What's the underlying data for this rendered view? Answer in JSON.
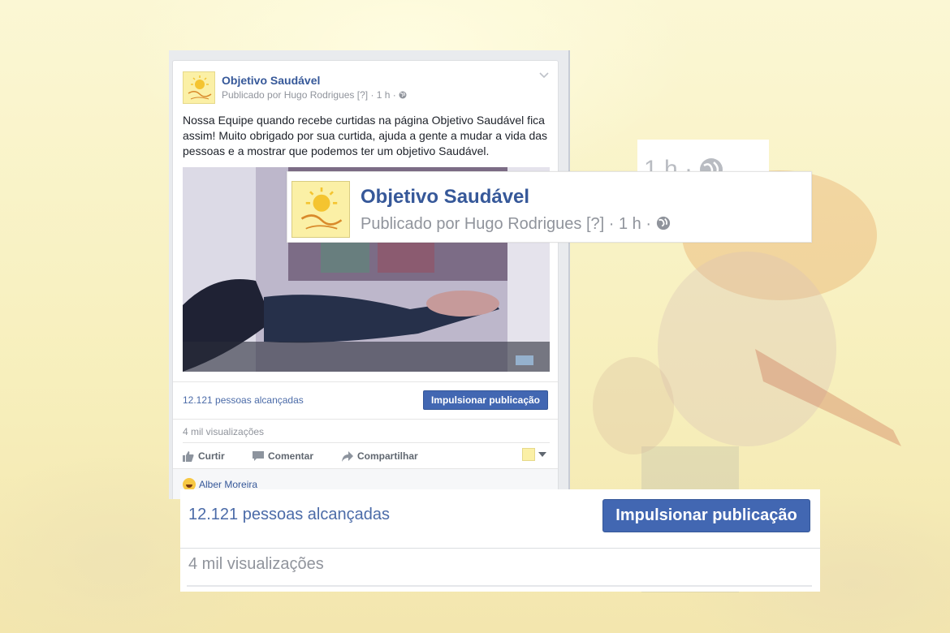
{
  "post": {
    "page_name": "Objetivo Saudável",
    "byline": "Publicado por Hugo Rodrigues [?] · 1 h ·",
    "text": "Nossa Equipe quando recebe curtidas na página Objetivo Saudável fica assim! Muito obrigado por sua curtida, ajuda a gente a mudar a vida das pessoas e a mostrar que podemos ter um objetivo Saudável.",
    "reach": "12.121 pessoas alcançadas",
    "boost_label": "Impulsionar publicação",
    "views": "4 mil visualizações",
    "actions": {
      "like": "Curtir",
      "comment": "Comentar",
      "share": "Compartilhar"
    },
    "commenter": "Alber Moreira"
  },
  "zoom_time": {
    "text": "1 h ·"
  },
  "zoom_header": {
    "page_name": "Objetivo Saudável",
    "byline": "Publicado por Hugo Rodrigues [?] · 1 h ·"
  },
  "zoom_bottom": {
    "reach": "12.121 pessoas alcançadas",
    "boost_label": "Impulsionar publicação",
    "views": "4 mil visualizações"
  },
  "colors": {
    "facebook_blue": "#4267b2",
    "link_blue": "#365899",
    "muted_gray": "#90949c",
    "background_yellow": "#faf4c6"
  },
  "icons": [
    "globe-icon",
    "chevron-down-icon",
    "like-icon",
    "comment-icon",
    "share-icon",
    "haha-reaction-icon"
  ]
}
